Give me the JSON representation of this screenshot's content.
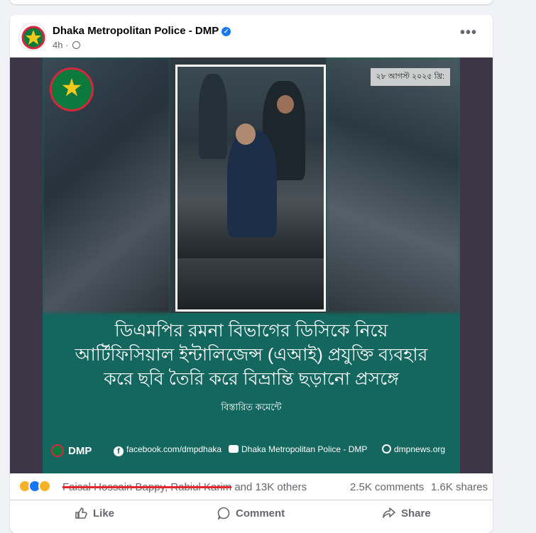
{
  "post": {
    "page_name": "Dhaka Metropolitan Police - DMP",
    "time": "4h",
    "more_label": "•••"
  },
  "poster": {
    "date": "২৮ আগস্ট ২০২৫ খ্রি:",
    "line1": "ডিএমপির রমনা বিভাগের ডিসিকে নিয়ে",
    "line2": "আর্টিফিসিয়াল ইন্টালিজেন্স (এআই) প্রযুক্তি ব্যবহার",
    "line3": "করে ছবি তৈরি করে বিভ্রান্তি ছড়ানো প্রসঙ্গে",
    "detail": "বিস্তারিত কমেন্টে",
    "dmp": "DMP",
    "facebook": "facebook.com/dmpdhaka",
    "youtube": "Dhaka Metropolitan Police - DMP",
    "website": "dmpnews.org"
  },
  "stats": {
    "struck_names": "Faisal Hossain Bappy, Rabiul Karim",
    "others": " and 13K others",
    "comments": "2.5K comments",
    "shares": "1.6K shares"
  },
  "actions": {
    "like": "Like",
    "comment": "Comment",
    "share": "Share"
  },
  "colors": {
    "poster_green": "#13675e",
    "like_blue": "#1877f2",
    "strike_red": "#e4272d"
  }
}
